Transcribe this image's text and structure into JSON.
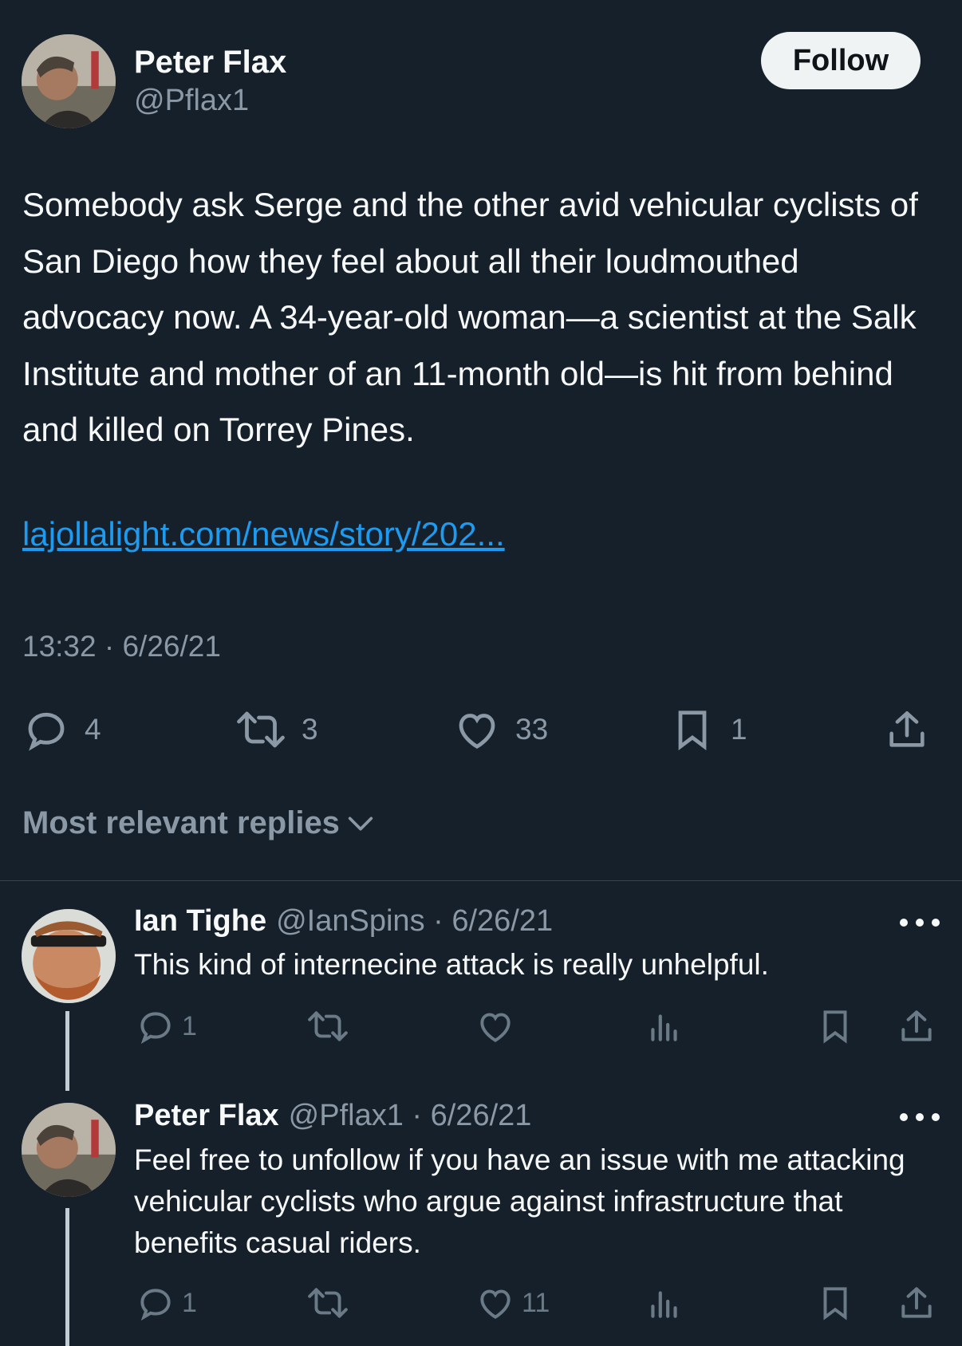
{
  "tweet": {
    "author_name": "Peter Flax",
    "author_handle": "@Pflax1",
    "follow_label": "Follow",
    "text": "Somebody ask Serge and the other avid vehicular cyclists of San Diego how they feel about all their loudmouthed advocacy now. A 34-year-old woman—a scientist at the Salk Institute and mother of an 11-month old—is hit from behind and killed on Torrey Pines.",
    "link": "lajollalight.com/news/story/202...",
    "timestamp": "13:32 · 6/26/21",
    "replies": "4",
    "retweets": "3",
    "likes": "33",
    "bookmarks": "1"
  },
  "sort": {
    "label": "Most relevant replies"
  },
  "replies": [
    {
      "name": "Ian Tighe",
      "meta": "@IanSpins · 6/26/21",
      "text": "This kind of internecine attack is really unhelpful.",
      "reply_count": "1",
      "like_count": ""
    },
    {
      "name": "Peter Flax",
      "meta": "@Pflax1 · 6/26/21",
      "text": "Feel free to unfollow if you have an issue with me attacking vehicular cyclists who argue against infrastructure that benefits casual riders.",
      "reply_count": "1",
      "like_count": "11"
    }
  ],
  "icons": {
    "reply": "reply-icon",
    "retweet": "retweet-icon",
    "like": "heart-icon",
    "bookmark": "bookmark-icon",
    "share": "share-icon",
    "views": "views-icon",
    "more": "more-icon",
    "sort_chevron": "chevron-down-icon"
  },
  "colors": {
    "background": "#15202b",
    "text": "#f7f9f9",
    "secondary": "#8b98a5",
    "link": "#1d9bf0",
    "follow_button": "#eff3f4"
  }
}
